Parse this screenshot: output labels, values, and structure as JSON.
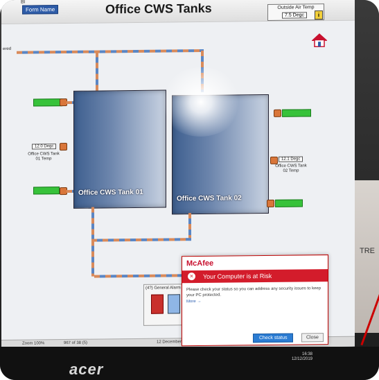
{
  "window": {
    "title": "Office CWS Tanks",
    "nav_top": "Bl",
    "nav_button": "Form Name"
  },
  "outside": {
    "label": "Outside Air Temp",
    "value": "7.5 Degc",
    "info": "i"
  },
  "left_side": {
    "inlet_label": "ered",
    "tag_top": "",
    "temp_value": "12.0 Degc",
    "temp_label": "Office CWS Tank 01 Temp",
    "tag_bottom": ""
  },
  "right_side": {
    "tag_top": "",
    "temp_value": "12.1 Degc",
    "temp_label": "Office CWS Tank 02 Temp",
    "tag_bottom": ""
  },
  "tanks": [
    {
      "name": "Office CWS Tank 01"
    },
    {
      "name": "Office CWS Tank 02"
    }
  ],
  "alarm": {
    "label": "(4?) General Alarm"
  },
  "status_bar": {
    "zoom": "Zoom 100%",
    "coords": "967 of 38 (5)",
    "date_text": "12 December"
  },
  "popup": {
    "brand": "McAfee",
    "warning": "Your Computer is at Risk",
    "body": "Please check your status so you can address any security issues to keep your PC protected.",
    "more": "More →",
    "check_button": "Check status",
    "close_button": "Close"
  },
  "taskbar": {
    "time": "16:38",
    "date": "12/12/2019"
  },
  "monitor": {
    "brand": "acer"
  },
  "wall": {
    "text": "TRE"
  },
  "colors": {
    "tank_blue": "#3e5f8f",
    "tag_green": "#37c23a",
    "valve_orange": "#d9763a",
    "alert_red": "#d31c2b"
  }
}
